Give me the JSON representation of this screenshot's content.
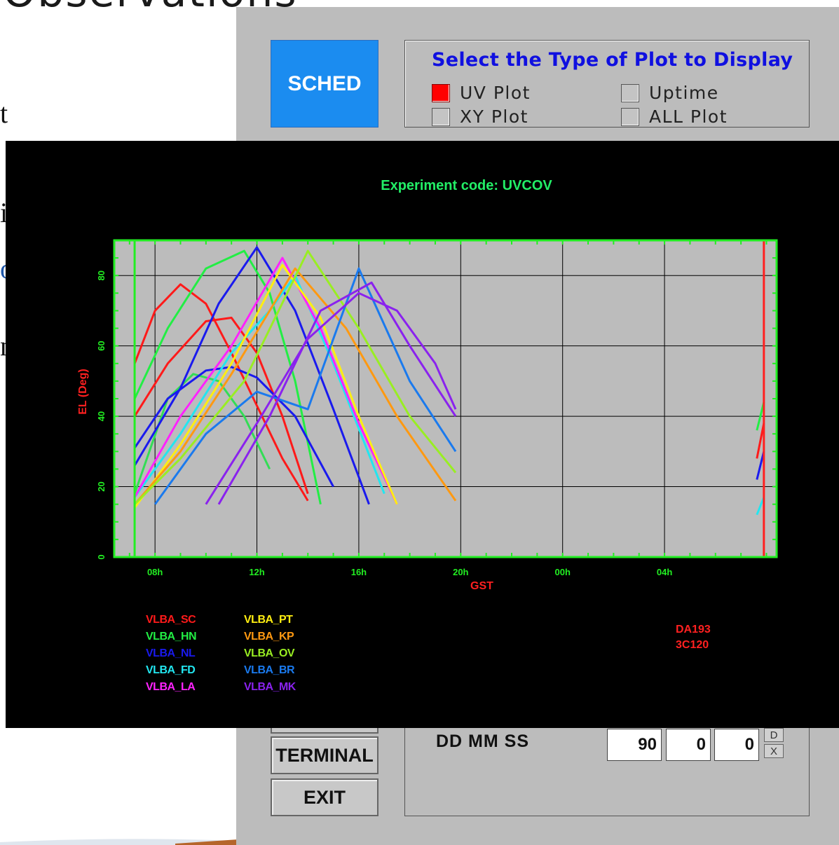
{
  "background": {
    "title": "Observations",
    "frag1": "t",
    "frag2": "i",
    "frag3": "o",
    "frag4": "n"
  },
  "toolbar": {
    "sched_label": "SCHED",
    "plot_select_title": "Select the Type of Plot to Display",
    "options": [
      {
        "label": "UV Plot",
        "checked": true
      },
      {
        "label": "XY Plot",
        "checked": false
      },
      {
        "label": "Uptime",
        "checked": false
      },
      {
        "label": "ALL Plot",
        "checked": false
      }
    ]
  },
  "plot": {
    "title": "Experiment code: UVCOV",
    "xlabel": "GST",
    "ylabel": "EL (Deg)",
    "sources": [
      "DA193",
      "3C120"
    ],
    "colors": {
      "frame": "#22ee22",
      "plot_bg": "#bcbcbc",
      "title": "#22ee66",
      "label": "#ff2020",
      "marker": "#ff2020"
    }
  },
  "chart_data": {
    "type": "line",
    "title": "Experiment code: UVCOV",
    "xlabel": "GST",
    "ylabel": "EL (Deg)",
    "x_tick_labels": [
      "08h",
      "12h",
      "16h",
      "20h",
      "00h",
      "04h"
    ],
    "y_tick_labels": [
      "0",
      "20",
      "40",
      "60",
      "80"
    ],
    "ylim": [
      0,
      90
    ],
    "xlim_hours": [
      6.4,
      32.4
    ],
    "grid": true,
    "series": [
      {
        "name": "VLBA_SC",
        "color": "#ff1a1a",
        "x": [
          7.2,
          8.0,
          9.0,
          10.0,
          11.0,
          12.0,
          13.0,
          14.0
        ],
        "y": [
          55,
          70,
          77.5,
          72,
          58,
          43,
          28,
          16
        ]
      },
      {
        "name": "VLBA_SC",
        "color": "#ff1a1a",
        "x": [
          7.2,
          8.5,
          10.0,
          11.0,
          12.0,
          13.0,
          14.0
        ],
        "y": [
          40,
          55,
          67,
          68,
          58,
          40,
          18
        ]
      },
      {
        "name": "VLBA_HN",
        "color": "#22ee44",
        "x": [
          7.2,
          8.5,
          10.0,
          11.5,
          12.5,
          13.5,
          14.5
        ],
        "y": [
          45,
          65,
          82,
          87,
          75,
          50,
          15
        ]
      },
      {
        "name": "VLBA_HN",
        "color": "#33dd55",
        "x": [
          7.2,
          8.5,
          9.5,
          10.5,
          11.5,
          12.5
        ],
        "y": [
          18,
          45,
          52,
          50,
          40,
          25
        ]
      },
      {
        "name": "VLBA_NL",
        "color": "#1a1aee",
        "x": [
          7.2,
          9.0,
          10.5,
          12.0,
          13.5,
          15.0,
          16.4
        ],
        "y": [
          26,
          48,
          72,
          88,
          70,
          42,
          15
        ]
      },
      {
        "name": "VLBA_NL",
        "color": "#1a1aee",
        "x": [
          7.2,
          8.5,
          10.0,
          11.0,
          12.0,
          13.5,
          15.0
        ],
        "y": [
          31,
          45,
          53,
          54,
          51,
          40,
          20
        ]
      },
      {
        "name": "VLBA_FD",
        "color": "#22e6f0",
        "x": [
          7.2,
          9.0,
          11.0,
          12.5,
          13.5,
          15.0,
          17.0
        ],
        "y": [
          17,
          35,
          58,
          70,
          80,
          55,
          18
        ]
      },
      {
        "name": "VLBA_LA",
        "color": "#ff22ff",
        "x": [
          7.2,
          9.0,
          11.0,
          13.0,
          14.5,
          16.0,
          17.5
        ],
        "y": [
          17,
          40,
          60,
          85,
          65,
          38,
          15
        ]
      },
      {
        "name": "VLBA_PT",
        "color": "#ffee11",
        "x": [
          7.2,
          9.0,
          11.0,
          13.0,
          14.5,
          16.0,
          17.5
        ],
        "y": [
          14,
          32,
          55,
          83,
          68,
          40,
          15
        ]
      },
      {
        "name": "VLBA_KP",
        "color": "#ff9911",
        "x": [
          7.2,
          9.0,
          11.0,
          13.5,
          15.5,
          17.5,
          19.8
        ],
        "y": [
          15,
          30,
          52,
          82,
          65,
          40,
          16
        ]
      },
      {
        "name": "VLBA_OV",
        "color": "#99ee22",
        "x": [
          7.2,
          9.0,
          11.5,
          14.0,
          16.0,
          18.0,
          19.8
        ],
        "y": [
          15,
          28,
          50,
          87,
          65,
          40,
          24
        ]
      },
      {
        "name": "VLBA_BR",
        "color": "#1a7aee",
        "x": [
          8.0,
          10.0,
          12.0,
          14.0,
          16.0,
          18.0,
          19.8
        ],
        "y": [
          15,
          35,
          47,
          42,
          82,
          50,
          30
        ]
      },
      {
        "name": "VLBA_MK",
        "color": "#8a22ee",
        "x": [
          10.0,
          12.0,
          14.0,
          16.0,
          17.5,
          19.0,
          19.8
        ],
        "y": [
          15,
          38,
          62,
          75,
          70,
          55,
          42
        ]
      },
      {
        "name": "VLBA_MK",
        "color": "#8a22ee",
        "x": [
          10.5,
          12.5,
          14.5,
          16.5,
          18.0,
          19.8
        ],
        "y": [
          15,
          40,
          70,
          78,
          60,
          40
        ]
      }
    ],
    "legend": [
      "VLBA_SC",
      "VLBA_HN",
      "VLBA_NL",
      "VLBA_FD",
      "VLBA_LA",
      "VLBA_PT",
      "VLBA_KP",
      "VLBA_OV",
      "VLBA_BR",
      "VLBA_MK"
    ],
    "legend_colors": [
      "#ff1a1a",
      "#22ee44",
      "#1a1aee",
      "#22e6f0",
      "#ff22ff",
      "#ffee11",
      "#ff9911",
      "#99ee22",
      "#1a7aee",
      "#8a22ee"
    ],
    "start_marker_hours": 7.2,
    "end_marker_hours": 31.9
  },
  "bottom": {
    "terminal_label": "TERMINAL",
    "exit_label": "EXIT",
    "coord_label": "DD MM SS",
    "dd": "90",
    "mm": "0",
    "ss": "0",
    "up_arrow": "D",
    "down_arrow": "X"
  }
}
